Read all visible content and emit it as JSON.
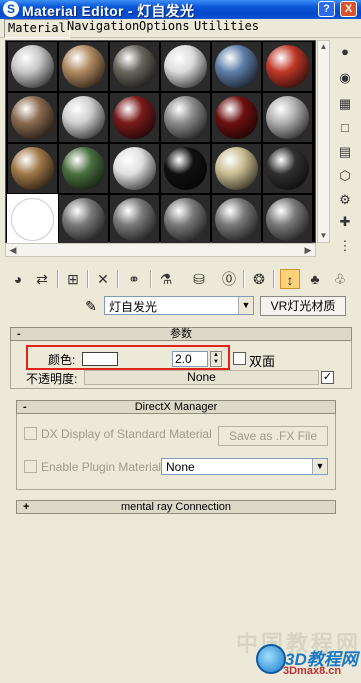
{
  "window": {
    "app_icon": "S",
    "title": "Material Editor - 灯自发光",
    "help_label": "?",
    "close_label": "X"
  },
  "menu": [
    "Material",
    "Navigation",
    "Options",
    "Utilities"
  ],
  "slots": [
    "#c8c8c8",
    "#b08a60",
    "#6a665e",
    "#dcdcdc",
    "#5f7fa8",
    "#c03828",
    "#8a6a50",
    "#cfcfcf",
    "#7a1a1a",
    "#8c8c8c",
    "#6e1010",
    "#b0b0b0",
    "#a07848",
    "#4a7040",
    "#e0e0e0",
    "#101010",
    "#c8bc90",
    "#303030",
    "#ffffff",
    "#7a7a7a",
    "#7a7a7a",
    "#7a7a7a",
    "#7a7a7a",
    "#7a7a7a"
  ],
  "toolbar": {
    "icons": [
      "get-material-icon",
      "put-to-scene-icon",
      "assign-material-icon",
      "reset-icon",
      "make-copy-icon",
      "make-unique-icon",
      "put-to-library-icon",
      "material-id-icon",
      "show-in-viewport-icon",
      "show-end-result-icon",
      "go-parent-icon",
      "go-sibling-icon"
    ]
  },
  "material": {
    "name": "灯自发光",
    "type_button": "VR灯光材质"
  },
  "params": {
    "header_sign": "-",
    "header": "参数",
    "color_label": "颜色:",
    "intensity": "2.0",
    "two_sided_label": "双面",
    "opacity_label": "不透明度:",
    "opacity_map": "None",
    "opacity_check": "✓"
  },
  "directx": {
    "header_sign": "-",
    "header": "DirectX Manager",
    "dx_display_label": "DX Display of Standard Material",
    "save_fx_label": "Save as .FX File",
    "enable_plugin_label": "Enable Plugin Material",
    "plugin_value": "None"
  },
  "mentalray": {
    "header_sign": "+",
    "header": "mental ray Connection"
  },
  "watermark": {
    "top": "中国教程网",
    "site": "3D教程网",
    "url": "3Dmax8.cn"
  },
  "colors": {
    "title_bar": "#0a58d8",
    "highlight": "#e0241b",
    "panel_bg": "#ece9d8"
  }
}
